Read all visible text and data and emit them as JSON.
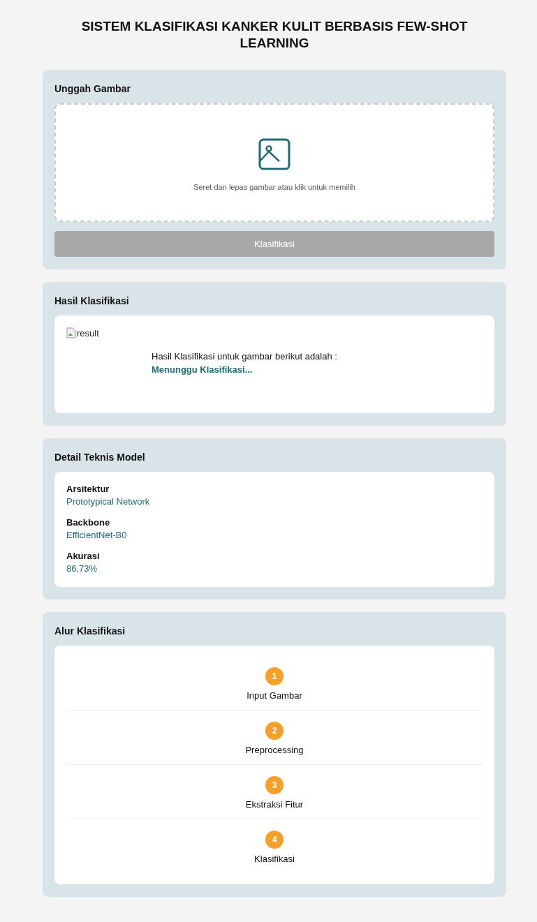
{
  "title": "SISTEM KLASIFIKASI KANKER KULIT BERBASIS FEW-SHOT LEARNING",
  "upload": {
    "heading": "Unggah Gambar",
    "hint": "Seret dan lepas gambar atau klik untuk memilih",
    "button": {
      "label": "Klasifikasi",
      "disabled": true
    }
  },
  "result": {
    "heading": "Hasil Klasifikasi",
    "image_alt": "result",
    "caption": "Hasil Klasifikasi untuk gambar berikut adalah :",
    "status": "Menunggu Klasifikasi..."
  },
  "model": {
    "heading": "Detail Teknis Model",
    "details": [
      {
        "label": "Arsitektur",
        "value": "Prototypical Network"
      },
      {
        "label": "Backbone",
        "value": "EfficientNet-B0"
      },
      {
        "label": "Akurasi",
        "value": "86,73%"
      }
    ]
  },
  "flow": {
    "heading": "Alur Klasifikasi",
    "steps": [
      {
        "number": "1",
        "label": "Input Gambar"
      },
      {
        "number": "2",
        "label": "Preprocessing"
      },
      {
        "number": "3",
        "label": "Ekstraksi Fitur"
      },
      {
        "number": "4",
        "label": "Klasifikasi"
      }
    ]
  }
}
